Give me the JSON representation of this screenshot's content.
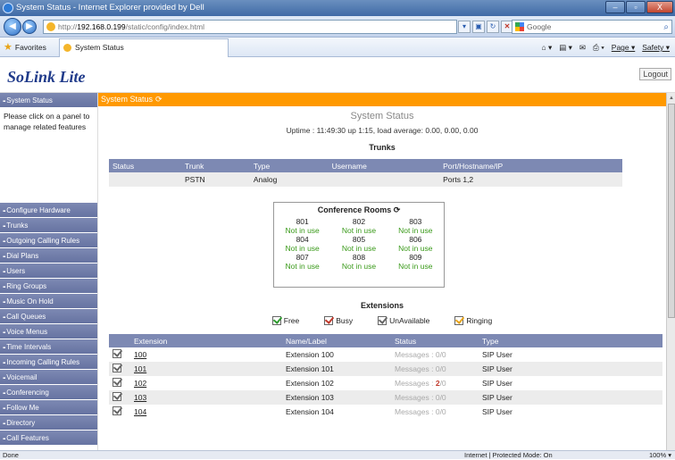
{
  "window": {
    "title": "System Status - Internet Explorer provided by Dell",
    "buttons": [
      "–",
      "▫",
      "X"
    ]
  },
  "address": {
    "url_prefix": "http://",
    "url_host": "192.168.0.199",
    "url_path": "/static/config/index.html",
    "search_placeholder": "Google"
  },
  "favbar": {
    "favorites_label": "Favorites",
    "tab_label": "System Status",
    "page_label": "Page ▾",
    "safety_label": "Safety ▾"
  },
  "app": {
    "logo": "SoLink Lite",
    "logout": "Logout"
  },
  "sidebar": {
    "top_item": "System Status",
    "note": "Please click on a panel to manage related features",
    "items": [
      "Configure Hardware",
      "Trunks",
      "Outgoing Calling Rules",
      "Dial Plans",
      "Users",
      "Ring Groups",
      "Music On Hold",
      "Call Queues",
      "Voice Menus",
      "Time Intervals",
      "Incoming Calling Rules",
      "Voicemail",
      "Conferencing",
      "Follow Me",
      "Directory",
      "Call Features"
    ]
  },
  "content": {
    "header": "System Status",
    "title": "System Status",
    "uptime": "Uptime : 11:49:30 up 1:15, load average: 0.00, 0.00, 0.00",
    "trunks_title": "Trunks",
    "trunks_columns": [
      "Status",
      "Trunk",
      "Type",
      "Username",
      "Port/Hostname/IP"
    ],
    "trunks_rows": [
      [
        "",
        "PSTN",
        "Analog",
        "",
        "Ports 1,2"
      ]
    ],
    "conference_title": "Conference Rooms",
    "conference_rooms": [
      {
        "num": "801",
        "status": "Not in use"
      },
      {
        "num": "802",
        "status": "Not in use"
      },
      {
        "num": "803",
        "status": "Not in use"
      },
      {
        "num": "804",
        "status": "Not in use"
      },
      {
        "num": "805",
        "status": "Not in use"
      },
      {
        "num": "806",
        "status": "Not in use"
      },
      {
        "num": "807",
        "status": "Not in use"
      },
      {
        "num": "808",
        "status": "Not in use"
      },
      {
        "num": "809",
        "status": "Not in use"
      }
    ],
    "extensions_title": "Extensions",
    "legend": [
      {
        "label": "Free",
        "color": "#2e9a2e"
      },
      {
        "label": "Busy",
        "color": "#c0392b"
      },
      {
        "label": "UnAvailable",
        "color": "#666666"
      },
      {
        "label": "Ringing",
        "color": "#e8a317"
      }
    ],
    "ext_columns": [
      "Extension",
      "Name/Label",
      "Status",
      "Type"
    ],
    "ext_rows": [
      {
        "ext": "100",
        "name": "Extension 100",
        "msg_prefix": "Messages : ",
        "msg_new": "0",
        "msg_old": "/0",
        "type": "SIP User"
      },
      {
        "ext": "101",
        "name": "Extension 101",
        "msg_prefix": "Messages : ",
        "msg_new": "0",
        "msg_old": "/0",
        "type": "SIP User"
      },
      {
        "ext": "102",
        "name": "Extension 102",
        "msg_prefix": "Messages : ",
        "msg_new": "2",
        "msg_old": "/0",
        "type": "SIP User"
      },
      {
        "ext": "103",
        "name": "Extension 103",
        "msg_prefix": "Messages : ",
        "msg_new": "0",
        "msg_old": "/0",
        "type": "SIP User"
      },
      {
        "ext": "104",
        "name": "Extension 104",
        "msg_prefix": "Messages : ",
        "msg_new": "0",
        "msg_old": "/0",
        "type": "SIP User"
      }
    ]
  },
  "statusbar": {
    "left": "Done",
    "zone": "Internet | Protected Mode: On",
    "zoom": "100% ▾"
  }
}
